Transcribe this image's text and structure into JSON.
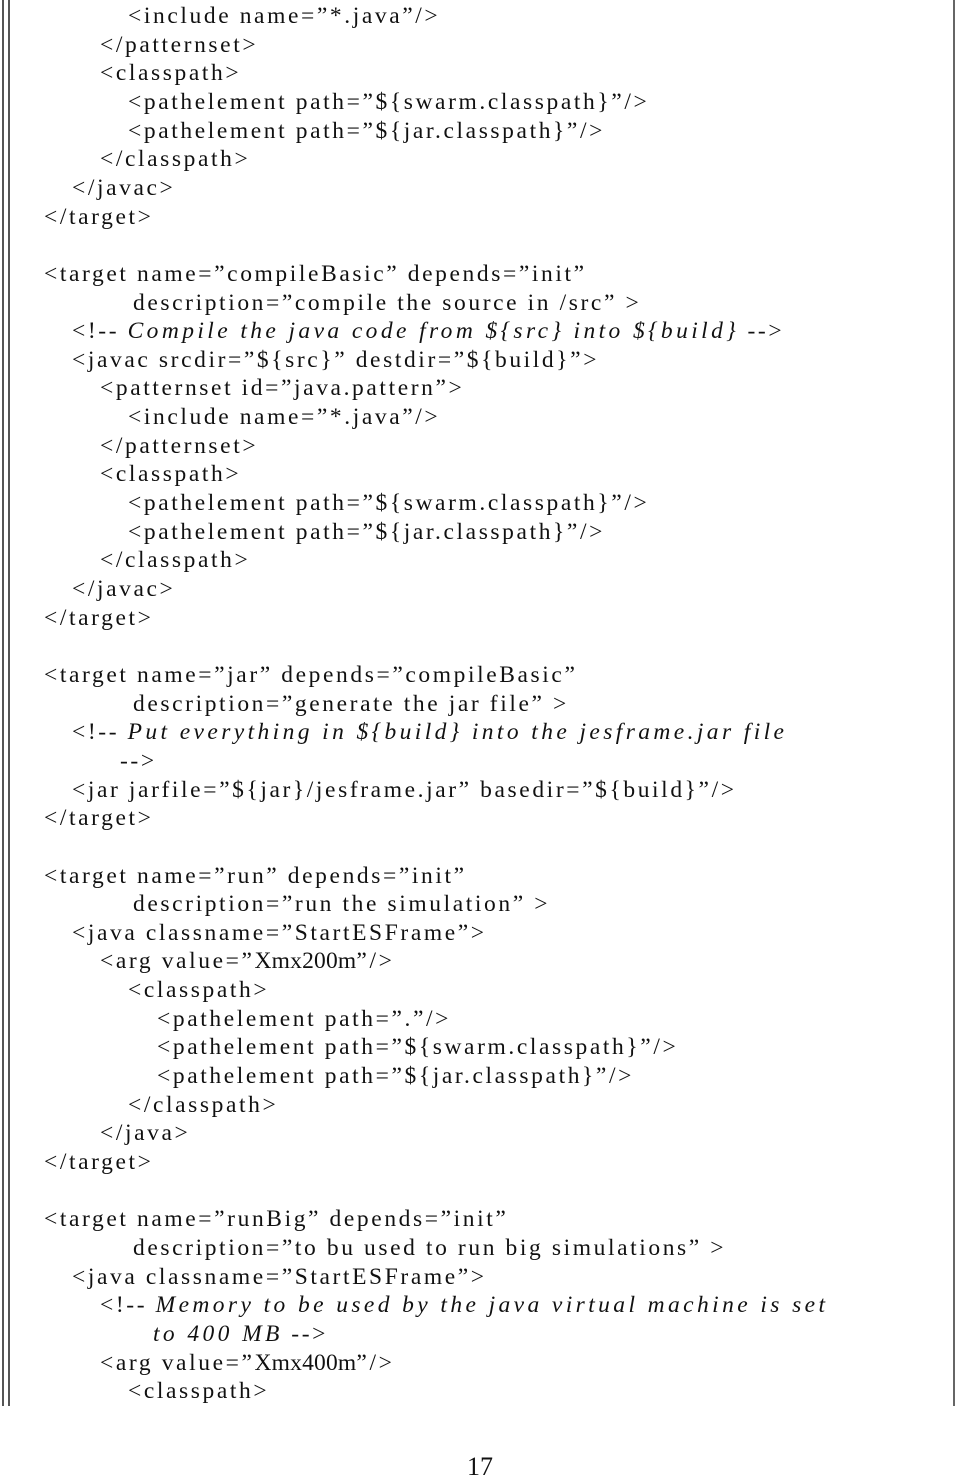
{
  "page_number": "17",
  "listing": [
    {
      "indent": 4,
      "parts": [
        {
          "t": "<include name=”*.java”/>"
        }
      ]
    },
    {
      "indent": 3,
      "parts": [
        {
          "t": "</patternset>"
        }
      ]
    },
    {
      "indent": 3,
      "parts": [
        {
          "t": "<classpath>"
        }
      ]
    },
    {
      "indent": 4,
      "parts": [
        {
          "t": "<pathelement path=”${swarm.classpath}”/>"
        }
      ]
    },
    {
      "indent": 4,
      "parts": [
        {
          "t": "<pathelement path=”${jar.classpath}”/>"
        }
      ]
    },
    {
      "indent": 3,
      "parts": [
        {
          "t": "</classpath>"
        }
      ]
    },
    {
      "indent": 2,
      "parts": [
        {
          "t": "</javac>"
        }
      ]
    },
    {
      "indent": 1,
      "parts": [
        {
          "t": "</target>"
        }
      ]
    },
    {
      "indent": 0,
      "parts": []
    },
    {
      "indent": 1,
      "parts": [
        {
          "t": "<target name=”compileBasic” depends=”init”"
        }
      ]
    },
    {
      "indent": 5,
      "parts": [
        {
          "t": "description=”compile the source in /src” >"
        }
      ]
    },
    {
      "indent": 2,
      "parts": [
        {
          "t": "<!-- "
        },
        {
          "t": "Compile the java code from ${src} into ${build}",
          "style": "comment"
        },
        {
          "t": " -->"
        }
      ]
    },
    {
      "indent": 2,
      "parts": [
        {
          "t": "<javac srcdir=”${src}” destdir=”${build}”>"
        }
      ]
    },
    {
      "indent": 3,
      "parts": [
        {
          "t": "<patternset id=”java.pattern”>"
        }
      ]
    },
    {
      "indent": 4,
      "parts": [
        {
          "t": "<include name=”*.java”/>"
        }
      ]
    },
    {
      "indent": 3,
      "parts": [
        {
          "t": "</patternset>"
        }
      ]
    },
    {
      "indent": 3,
      "parts": [
        {
          "t": "<classpath>"
        }
      ]
    },
    {
      "indent": 4,
      "parts": [
        {
          "t": "<pathelement path=”${swarm.classpath}”/>"
        }
      ]
    },
    {
      "indent": 4,
      "parts": [
        {
          "t": "<pathelement path=”${jar.classpath}”/>"
        }
      ]
    },
    {
      "indent": 3,
      "parts": [
        {
          "t": "</classpath>"
        }
      ]
    },
    {
      "indent": 2,
      "parts": [
        {
          "t": "</javac>"
        }
      ]
    },
    {
      "indent": 1,
      "parts": [
        {
          "t": "</target>"
        }
      ]
    },
    {
      "indent": 0,
      "parts": []
    },
    {
      "indent": 1,
      "parts": [
        {
          "t": "<target name=”jar” depends=”compileBasic”"
        }
      ]
    },
    {
      "indent": 5,
      "parts": [
        {
          "t": "description=”generate the jar file” >"
        }
      ]
    },
    {
      "indent": 2,
      "parts": [
        {
          "t": "<!-- "
        },
        {
          "t": "Put everything in ${build} into the jesframe.jar file",
          "style": "comment"
        }
      ]
    },
    {
      "indent": 6,
      "parts": [
        {
          "t": "-->"
        }
      ]
    },
    {
      "indent": 2,
      "parts": [
        {
          "t": "<jar jarfile=”${jar}/jesframe.jar” basedir=”${build}”/>"
        }
      ]
    },
    {
      "indent": 1,
      "parts": [
        {
          "t": "</target>"
        }
      ]
    },
    {
      "indent": 0,
      "parts": []
    },
    {
      "indent": 1,
      "parts": [
        {
          "t": "<target name=”run” depends=”init”"
        }
      ]
    },
    {
      "indent": 5,
      "parts": [
        {
          "t": "description=”run the simulation” >"
        }
      ]
    },
    {
      "indent": 2,
      "parts": [
        {
          "t": "<java classname=”StartESFrame”>"
        }
      ]
    },
    {
      "indent": 3,
      "parts": [
        {
          "t": "<arg value=”"
        },
        {
          "t": "Xmx200m",
          "style": "value"
        },
        {
          "t": "”/>"
        }
      ]
    },
    {
      "indent": 4,
      "parts": [
        {
          "t": "<classpath>"
        }
      ]
    },
    {
      "indent": 7,
      "parts": [
        {
          "t": "<pathelement path=”.”/>"
        }
      ]
    },
    {
      "indent": 7,
      "parts": [
        {
          "t": "<pathelement path=”${swarm.classpath}”/>"
        }
      ]
    },
    {
      "indent": 7,
      "parts": [
        {
          "t": "<pathelement path=”${jar.classpath}”/>"
        }
      ]
    },
    {
      "indent": 4,
      "parts": [
        {
          "t": "</classpath>"
        }
      ]
    },
    {
      "indent": 3,
      "parts": [
        {
          "t": "</java>"
        }
      ]
    },
    {
      "indent": 1,
      "parts": [
        {
          "t": "</target>"
        }
      ]
    },
    {
      "indent": 0,
      "parts": []
    },
    {
      "indent": 1,
      "parts": [
        {
          "t": "<target name=”runBig” depends=”init”"
        }
      ]
    },
    {
      "indent": 5,
      "parts": [
        {
          "t": "description=”to bu used to run big simulations” >"
        }
      ]
    },
    {
      "indent": 2,
      "parts": [
        {
          "t": "<java classname=”StartESFrame”>"
        }
      ]
    },
    {
      "indent": 3,
      "parts": [
        {
          "t": "<!-- "
        },
        {
          "t": "Memory to be used by the java virtual machine is set",
          "style": "comment"
        }
      ]
    },
    {
      "indent": 8,
      "parts": [
        {
          "t": "to 400 MB",
          "style": "comment"
        },
        {
          "t": " -->"
        }
      ]
    },
    {
      "indent": 3,
      "parts": [
        {
          "t": "<arg value=”"
        },
        {
          "t": "Xmx400m",
          "style": "value"
        },
        {
          "t": "”/>"
        }
      ]
    },
    {
      "indent": 4,
      "parts": [
        {
          "t": "<classpath>"
        }
      ]
    }
  ]
}
